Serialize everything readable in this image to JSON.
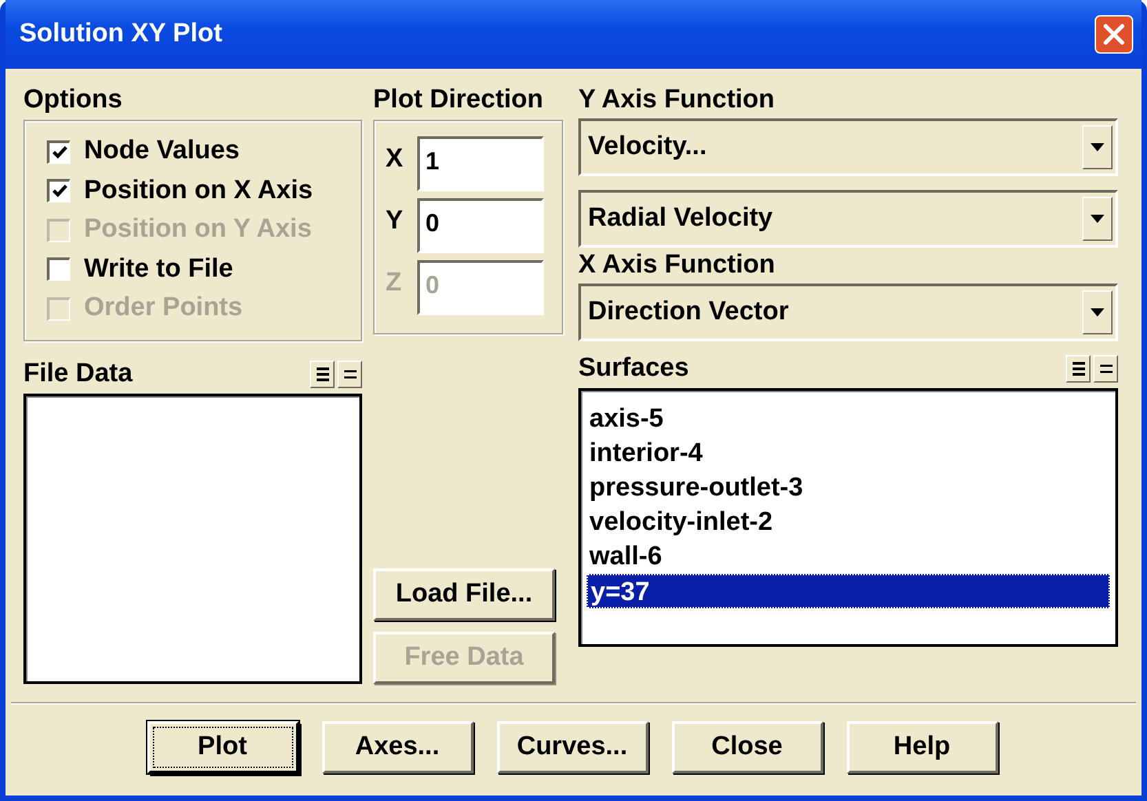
{
  "window": {
    "title": "Solution XY Plot"
  },
  "options": {
    "label": "Options",
    "items": [
      {
        "label": "Node Values",
        "checked": true,
        "disabled": false
      },
      {
        "label": "Position on X Axis",
        "checked": true,
        "disabled": false
      },
      {
        "label": "Position on Y Axis",
        "checked": false,
        "disabled": true
      },
      {
        "label": "Write to File",
        "checked": false,
        "disabled": false
      },
      {
        "label": "Order Points",
        "checked": false,
        "disabled": true
      }
    ]
  },
  "plot_direction": {
    "label": "Plot Direction",
    "fields": [
      {
        "label": "X",
        "value": "1",
        "disabled": false
      },
      {
        "label": "Y",
        "value": "0",
        "disabled": false
      },
      {
        "label": "Z",
        "value": "0",
        "disabled": true
      }
    ]
  },
  "file_data": {
    "label": "File Data"
  },
  "file_buttons": [
    {
      "label": "Load File...",
      "disabled": false
    },
    {
      "label": "Free Data",
      "disabled": true
    }
  ],
  "y_axis_function": {
    "label": "Y Axis Function",
    "dropdowns": [
      "Velocity...",
      "Radial Velocity"
    ]
  },
  "x_axis_function": {
    "label": "X Axis Function",
    "dropdowns": [
      "Direction Vector"
    ]
  },
  "surfaces": {
    "label": "Surfaces",
    "items": [
      {
        "label": "axis-5",
        "selected": false
      },
      {
        "label": "interior-4",
        "selected": false
      },
      {
        "label": "pressure-outlet-3",
        "selected": false
      },
      {
        "label": "velocity-inlet-2",
        "selected": false
      },
      {
        "label": "wall-6",
        "selected": false
      },
      {
        "label": "y=37",
        "selected": true
      }
    ]
  },
  "buttons": [
    {
      "label": "Plot",
      "focused": true
    },
    {
      "label": "Axes...",
      "focused": false
    },
    {
      "label": "Curves...",
      "focused": false
    },
    {
      "label": "Close",
      "focused": false
    },
    {
      "label": "Help",
      "focused": false
    }
  ]
}
